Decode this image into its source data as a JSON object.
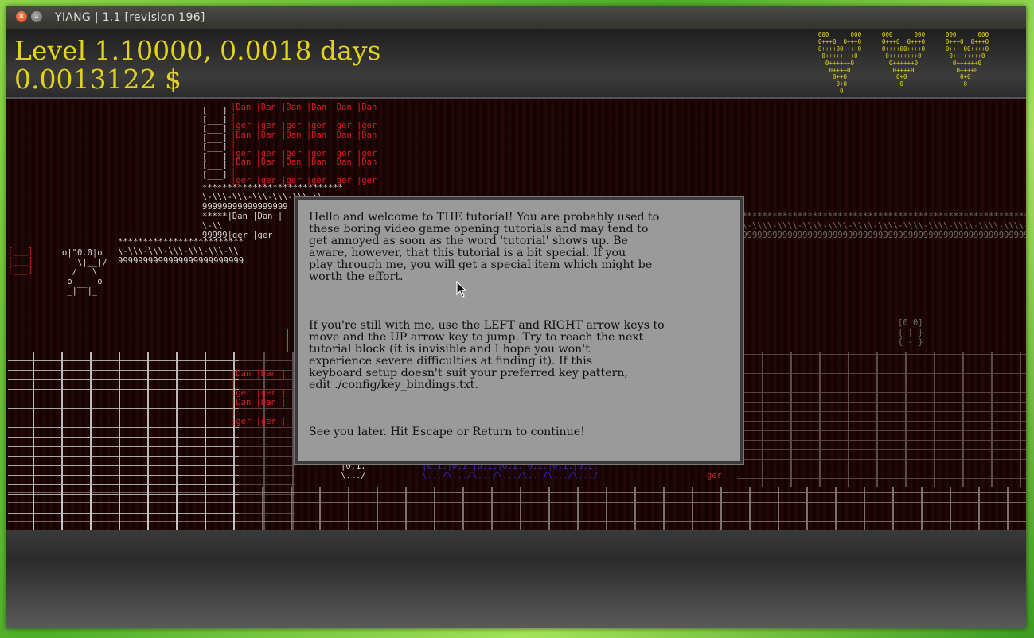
{
  "window": {
    "title": "YIANG | 1.1  [revision 196]",
    "close_label": "×",
    "menu_label": "⌄"
  },
  "hud": {
    "level": "Level 1.10000, 0.0018 days",
    "money": "0.0013122 $",
    "hearts": [
      " 000      000 \n0+++0  0+++0\n0++++00++++0\n 0++++++++0 \n  0++++++0  \n   0++++0   \n    0++0    \n     0+0    \n      0     ",
      " 000      000 \n0+++0  0+++0\n0++++00++++0\n 0++++++++0 \n  0++++++0  \n   0++++0   \n    0+0     \n     0      \n            ",
      " 000      000 \n0+++0  0+++0\n0++++00++++0\n 0++++++++0 \n  0++++++0  \n   0++++0   \n    0+0     \n     0      \n            "
    ],
    "color": "#e2d21a"
  },
  "dialog": {
    "paragraph1": "Hello and welcome to THE tutorial! You are probably used to\nthese boring video game opening tutorials and may tend to\nget annoyed as soon as the word 'tutorial' shows up. Be\naware, however, that this tutorial is a bit special. If you\nplay through me, you will get a special item which might be\nworth the effort.",
    "paragraph2": "If you're still with me, use the LEFT and RIGHT arrow keys to\nmove and the UP arrow key to jump. Try to reach the next\ntutorial block (it is invisible and I hope you won't\nexperience severe difficulties at finding it). If this\nkeyboard setup doesn't suit your preferred key pattern,\nedit ./config/key_bindings.txt.",
    "paragraph3": "See you later. Hit Escape or Return to continue!"
  },
  "scene": {
    "danger_rows": "|Dan |Dan |Dan |Dan |Dan |Dan \n|                             \n|ger |ger |ger |ger |ger |ger \n|Dan |Dan |Dan |Dan |Dan |Dan \n|                             \n|ger |ger |ger |ger |ger |ger \n|Dan |Dan |Dan |Dan |Dan |Dan \n|                             \n|ger |ger |ger |ger |ger |ger ",
    "tower_left": "[___]\n[___]\n[___]\n[___]\n[___]\n[___]\n[___]\n[___]",
    "bridge_top": "****************************\n\\-\\\\\\-\\\\\\-\\\\\\-\\\\\\-\\\\\\-\\\\\n99999999999999999",
    "left_stack": "*****|Dan |Dan |\n\\-\\\\ \n99999|ger |ger ",
    "mid_bridge": "*************************\n\\-\\\\\\-\\\\\\-\\\\\\-\\\\\\-\\\\\\-\\\\\n9999999999999999999999999",
    "player_ship": "o|\"0.0|o\n   \\|__|/\n  /   \\\n o     o\n _|‾‾|_",
    "left_blocks": "[___]\n[___]\n[___]",
    "right_bridge": "*****************************************************************\n\\\\-\\\\\\\\-\\\\\\\\-\\\\\\\\-\\\\\\\\-\\\\\\\\-\\\\\\\\-\\\\\\\\-\\\\\\\\-\\\\\\\\-\\\\\\\\-\\\\\\\\-\\\\\\\\-\\\\\n99999999999999999999999999999999999999999999999999999999999999999",
    "right_robot": "[0 0]\n{ | }\n{ - }",
    "lower_danger": "|Dan |Dan |\n|         \n|ger |ger |\n|Dan |Dan |\n|         \n|ger |ger |",
    "small_creature": "|0,1.\n\\.../",
    "blue_rows": "|0,1.|0,1.|0,1.|0,1.|0,1.|0,1.|0,1.\n\\.../\\.../\\.../\\.../\\.../\\.../\\.../",
    "ger_tag": "ger"
  }
}
